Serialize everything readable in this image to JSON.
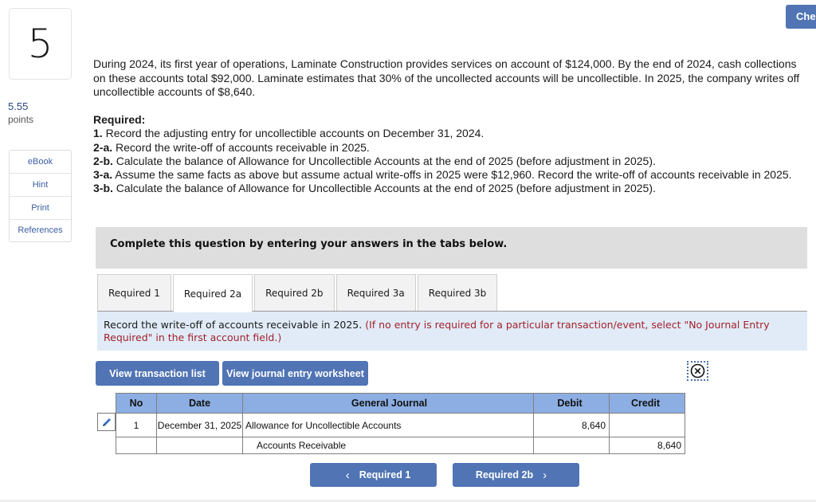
{
  "question": {
    "number": "5",
    "points_value": "5.55",
    "points_label": "points"
  },
  "side_links": [
    "eBook",
    "Hint",
    "Print",
    "References"
  ],
  "header": {
    "check_button_label": "Che"
  },
  "problem_text": "During 2024, its first year of operations, Laminate Construction provides services on account of $124,000. By the end of 2024, cash collections on these accounts total $92,000. Laminate estimates that 30% of the uncollected accounts will be uncollectible. In 2025, the company writes off uncollectible accounts of $8,640.",
  "required": {
    "heading": "Required:",
    "items": [
      {
        "label": "1.",
        "text": " Record the adjusting entry for uncollectible accounts on December 31, 2024."
      },
      {
        "label": "2-a.",
        "text": " Record the write-off of accounts receivable in 2025."
      },
      {
        "label": "2-b.",
        "text": " Calculate the balance of Allowance for Uncollectible Accounts at the end of 2025 (before adjustment in 2025)."
      },
      {
        "label": "3-a.",
        "text": " Assume the same facts as above but assume actual write-offs in 2025 were $12,960. Record the write-off of accounts receivable in 2025."
      },
      {
        "label": "3-b.",
        "text": " Calculate the balance of Allowance for Uncollectible Accounts at the end of 2025 (before adjustment in 2025)."
      }
    ]
  },
  "instruction": "Complete this question by entering your answers in the tabs below.",
  "tabs": [
    {
      "label": "Required 1",
      "active": false
    },
    {
      "label": "Required 2a",
      "active": true
    },
    {
      "label": "Required 2b",
      "active": false
    },
    {
      "label": "Required 3a",
      "active": false
    },
    {
      "label": "Required 3b",
      "active": false
    }
  ],
  "tab_note": {
    "main": "Record the write-off of accounts receivable in 2025. ",
    "hint": "(If no entry is required for a particular transaction/event, select \"No Journal Entry Required\" in the first account field.)"
  },
  "buttons": {
    "view_transaction_list": "View transaction list",
    "view_journal_worksheet": "View journal entry worksheet",
    "prev_label": "Required 1",
    "next_label": "Required 2b"
  },
  "journal": {
    "headers": {
      "no": "No",
      "date": "Date",
      "general_journal": "General Journal",
      "debit": "Debit",
      "credit": "Credit"
    },
    "rows": [
      {
        "no": "1",
        "date": "December 31, 2025",
        "account": "Allowance for Uncollectible Accounts",
        "debit": "8,640",
        "credit": ""
      },
      {
        "no": "",
        "date": "",
        "account": "Accounts Receivable",
        "debit": "",
        "credit": "8,640"
      }
    ]
  },
  "colors": {
    "button_blue": "#5074b4",
    "table_header_blue": "#8caee2",
    "note_background": "#e0ebf7",
    "hint_red": "#a3212b",
    "points_blue": "#2d4a86"
  }
}
